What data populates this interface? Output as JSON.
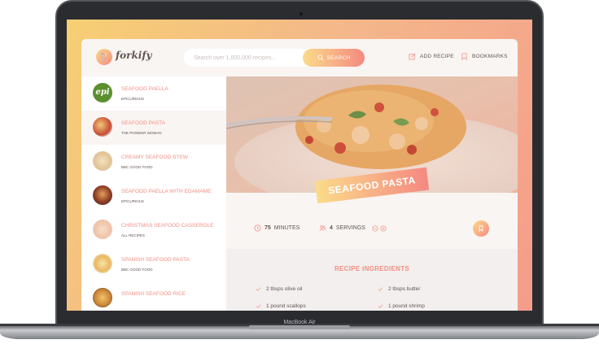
{
  "device": {
    "label": "MacBook Air"
  },
  "app": {
    "logo_text": "forkify",
    "search": {
      "placeholder": "Search over 1,000,000 recipes...",
      "button_label": "SEARCH"
    },
    "nav": {
      "add_recipe": "ADD RECIPE",
      "bookmarks": "BOOKMARKS"
    }
  },
  "results": [
    {
      "title": "SEAFOOD PAELLA",
      "publisher": "EPICURIOUS",
      "thumb": "epi-logo"
    },
    {
      "title": "SEAFOOD PASTA",
      "publisher": "THE PIONEER WOMAN",
      "thumb": "pasta-photo",
      "active": true
    },
    {
      "title": "CREAMY SEAFOOD STEW",
      "publisher": "BBC GOOD FOOD",
      "thumb": "stew-photo"
    },
    {
      "title": "SEAFOOD PAELLA WITH EDAMAME",
      "publisher": "EPICURIOUS",
      "thumb": "paella-photo"
    },
    {
      "title": "CHRISTMAS SEAFOOD CASSEROLE",
      "publisher": "ALL RECIPES",
      "thumb": "casserole-photo"
    },
    {
      "title": "SPANISH SEAFOOD PASTA",
      "publisher": "BBC GOOD FOOD",
      "thumb": "spanish-pasta-photo"
    },
    {
      "title": "SPANISH SEAFOOD RICE",
      "publisher": "",
      "thumb": "rice-photo"
    }
  ],
  "recipe": {
    "title": "SEAFOOD PASTA",
    "minutes_value": "75",
    "minutes_label": "MINUTES",
    "servings_value": "4",
    "servings_label": "SERVINGS",
    "ingredients_title": "RECIPE INGREDIENTS",
    "ingredients": [
      "2 tbsps olive oil",
      "2 tbsps butter",
      "1 pound scallops",
      "1 pound shrimp"
    ]
  },
  "colors": {
    "accent": "#f38e82",
    "gradient_start": "#fbdb89",
    "gradient_end": "#f48982",
    "text": "#615551"
  }
}
